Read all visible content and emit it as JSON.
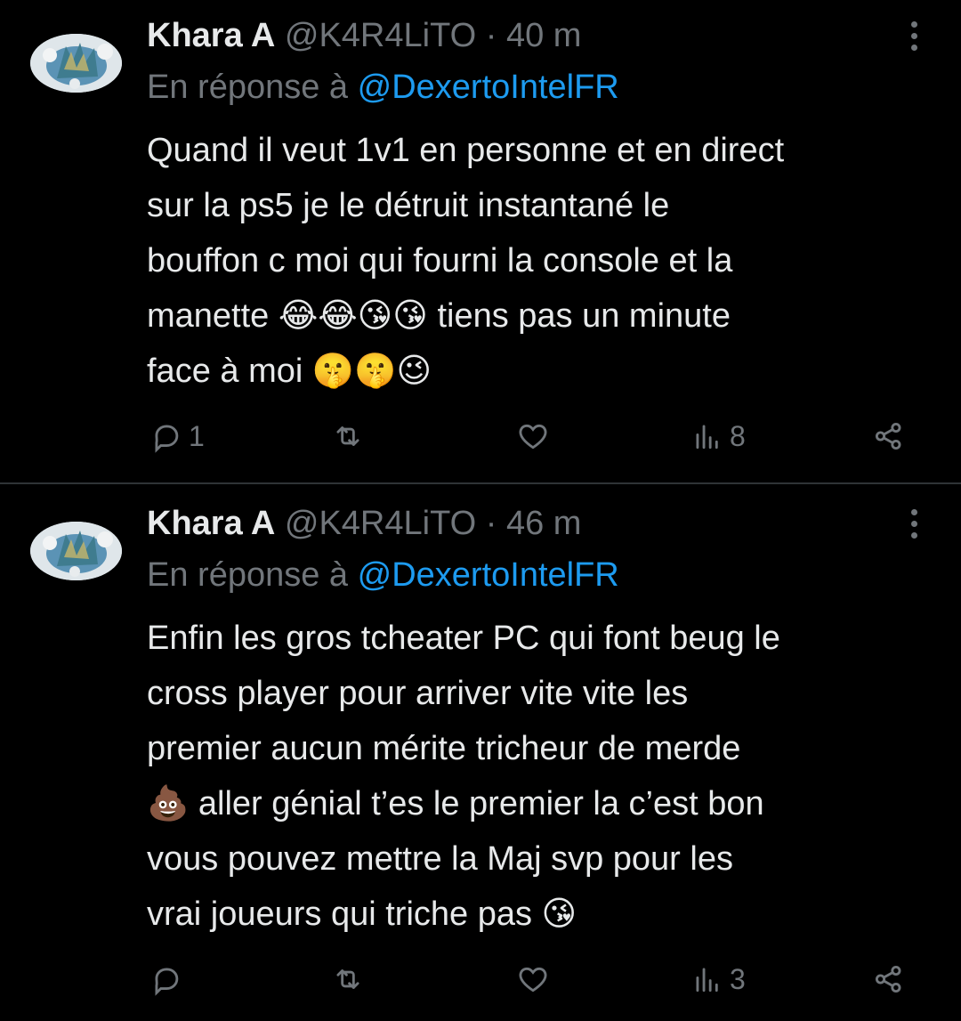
{
  "tweets": [
    {
      "author_name": "Khara A",
      "handle": "@K4R4LiTO",
      "separator": "·",
      "time": "40 m",
      "reply_prefix": "En réponse à",
      "reply_to": "@DexertoIntelFR",
      "text": "Quand il veut 1v1 en personne et en direct\nsur la ps5 je le détruit instantané le\nbouffon c moi qui fourni la console et la\nmanette 😂😂😘😘 tiens pas un minute\nface à moi 🤫🤫😉",
      "actions": {
        "replies": "1",
        "retweets": "",
        "likes": "",
        "views": "8"
      }
    },
    {
      "author_name": "Khara A",
      "handle": "@K4R4LiTO",
      "separator": "·",
      "time": "46 m",
      "reply_prefix": "En réponse à",
      "reply_to": "@DexertoIntelFR",
      "text": "Enfin les gros tcheater PC qui font beug le\ncross player pour arriver vite vite les\npremier aucun mérite tricheur de merde\n💩 aller génial t’es le premier la c’est bon\nvous pouvez mettre la Maj svp pour les\nvrai joueurs qui triche pas 😘",
      "actions": {
        "replies": "",
        "retweets": "",
        "likes": "",
        "views": "3"
      }
    }
  ],
  "icons": {
    "avatar": "avatar-image",
    "more": "more-vertical-icon",
    "reply": "reply-icon",
    "retweet": "retweet-icon",
    "like": "heart-icon",
    "views": "views-chart-icon",
    "share": "share-icon"
  },
  "colors": {
    "background": "#000000",
    "text_primary": "#e7e9ea",
    "text_secondary": "#71767b",
    "link": "#1d9bf0",
    "divider": "#2f3336"
  }
}
